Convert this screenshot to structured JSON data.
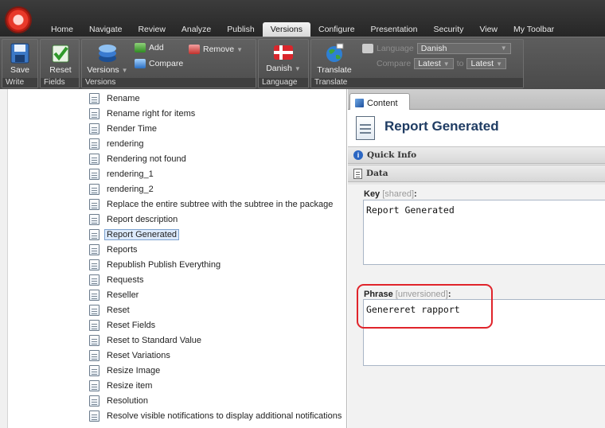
{
  "tabs": [
    "Home",
    "Navigate",
    "Review",
    "Analyze",
    "Publish",
    "Versions",
    "Configure",
    "Presentation",
    "Security",
    "View",
    "My Toolbar"
  ],
  "active_tab": "Versions",
  "ribbon": {
    "write": {
      "label": "Write",
      "save": "Save"
    },
    "fields": {
      "label": "Fields",
      "reset": "Reset"
    },
    "versions": {
      "label": "Versions",
      "versions_btn": "Versions",
      "add": "Add",
      "remove": "Remove",
      "compare": "Compare"
    },
    "language": {
      "label": "Language",
      "language_btn": "Danish"
    },
    "translate": {
      "label": "Translate",
      "translate_btn": "Translate",
      "language_label": "Language",
      "language_value": "Danish",
      "compare_label": "Compare",
      "compare_from": "Latest",
      "to_label": "to",
      "compare_to": "Latest"
    }
  },
  "tree": {
    "items": [
      "Rename",
      "Rename right for items",
      "Render Time",
      "rendering",
      "Rendering not found",
      "rendering_1",
      "rendering_2",
      "Replace the entire subtree with the subtree in the package",
      "Report description",
      "Report Generated",
      "Reports",
      "Republish Publish Everything",
      "Requests",
      "Reseller",
      "Reset",
      "Reset Fields",
      "Reset to Standard Value",
      "Reset Variations",
      "Resize Image",
      "Resize item",
      "Resolution",
      "Resolve visible notifications to display additional notifications"
    ],
    "selected": "Report Generated"
  },
  "content": {
    "tab_label": "Content",
    "title": "Report Generated",
    "quick_info": "Quick Info",
    "data_section": "Data",
    "key_label": "Key",
    "key_tag": "[shared]",
    "key_value": "Report Generated",
    "phrase_label": "Phrase",
    "phrase_tag": "[unversioned]",
    "phrase_value": "Genereret rapport",
    "colon": ":"
  },
  "colors": {
    "accent": "#1f3c63",
    "highlight": "#e0242b",
    "ribbon": "#4d4d4d"
  }
}
